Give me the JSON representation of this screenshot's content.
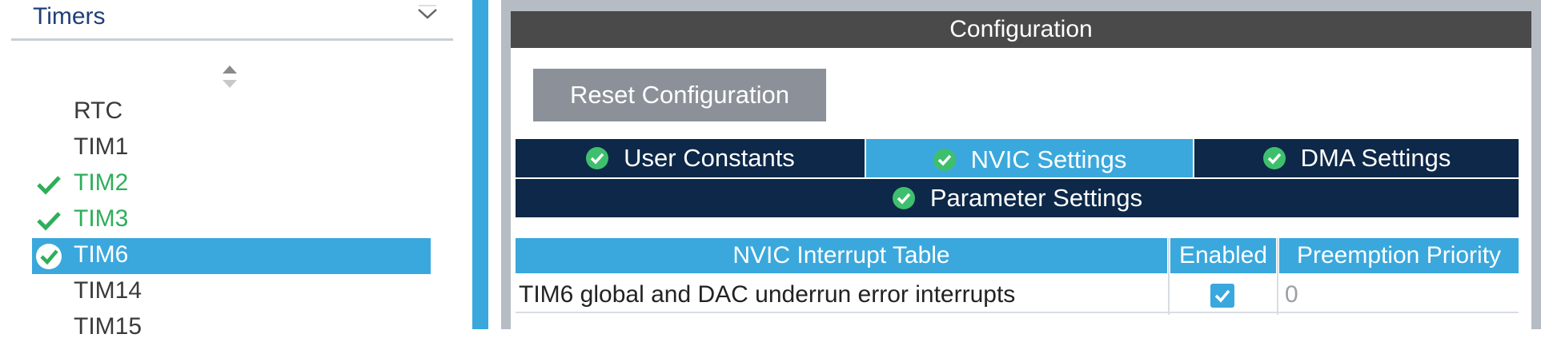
{
  "left": {
    "category": "Timers",
    "items": [
      {
        "label": "RTC",
        "state": "none"
      },
      {
        "label": "TIM1",
        "state": "none"
      },
      {
        "label": "TIM2",
        "state": "ok"
      },
      {
        "label": "TIM3",
        "state": "ok"
      },
      {
        "label": "TIM6",
        "state": "selected"
      },
      {
        "label": "TIM14",
        "state": "none"
      },
      {
        "label": "TIM15",
        "state": "none"
      }
    ]
  },
  "config": {
    "title": "Configuration",
    "reset_label": "Reset Configuration",
    "tabs": {
      "user_constants": "User Constants",
      "nvic_settings": "NVIC Settings",
      "dma_settings": "DMA Settings",
      "parameter_settings": "Parameter Settings"
    },
    "table": {
      "headers": [
        "NVIC Interrupt Table",
        "Enabled",
        "Preemption Priority"
      ],
      "rows": [
        {
          "name": "TIM6 global and DAC underrun error interrupts",
          "enabled": true,
          "priority": "0"
        }
      ]
    }
  },
  "colors": {
    "accent": "#3aa8dc",
    "tab_dark": "#0d2848",
    "ok_green": "#2fae5a",
    "title_bar": "#4a4a4a"
  }
}
